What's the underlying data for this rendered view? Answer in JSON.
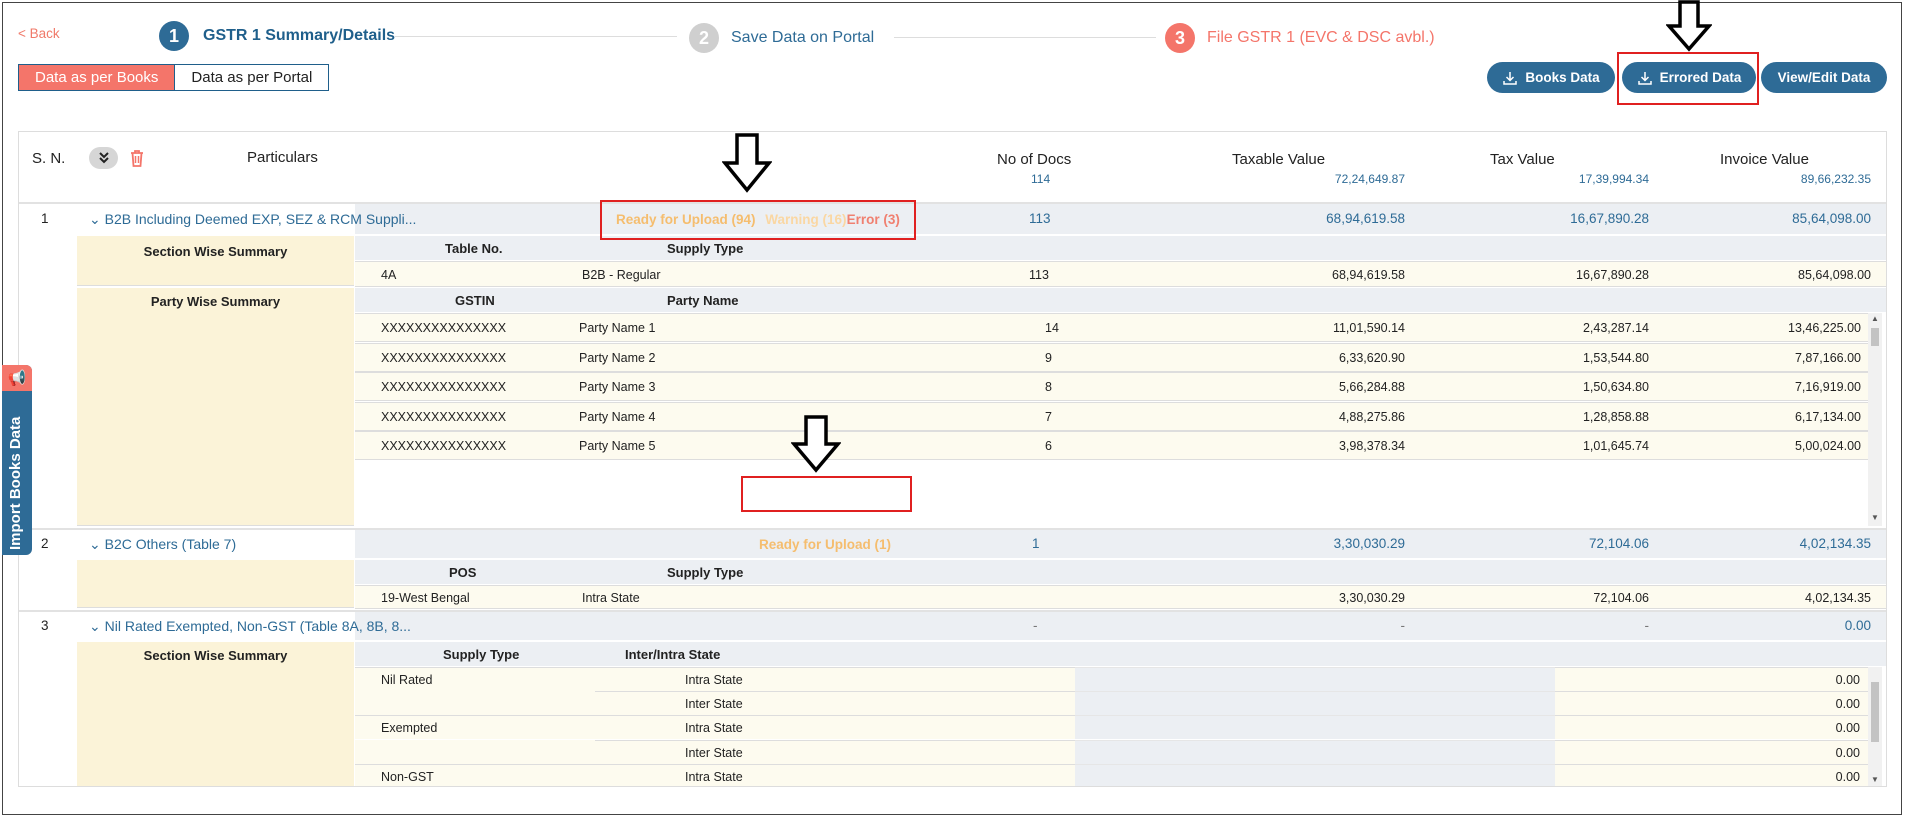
{
  "header": {
    "back": "< Back",
    "steps": [
      {
        "num": "1",
        "label": "GSTR 1 Summary/Details"
      },
      {
        "num": "2",
        "label": "Save Data on Portal"
      },
      {
        "num": "3",
        "label": "File GSTR 1 (EVC & DSC avbl.)"
      }
    ],
    "toggle": {
      "books": "Data as per Books",
      "portal": "Data as per Portal"
    },
    "buttons": {
      "books_data": "Books Data",
      "errored_data": "Errored Data",
      "view_edit": "View/Edit Data"
    }
  },
  "colors": {
    "brand": "#2e6b96",
    "accent": "#f4756a",
    "highlight": "#e02020"
  },
  "columns": {
    "sn": "S. N.",
    "particulars": "Particulars",
    "docs": "No of Docs",
    "taxable": "Taxable Value",
    "tax": "Tax Value",
    "invoice": "Invoice Value"
  },
  "totals": {
    "docs": "114",
    "taxable": "72,24,649.87",
    "tax": "17,39,994.34",
    "invoice": "89,66,232.35"
  },
  "sections": [
    {
      "sn": "1",
      "title": "B2B Including Deemed EXP, SEZ & RCM Suppli...",
      "status": {
        "ready": "Ready for Upload (94)",
        "warning": "Warning (16)",
        "error": "Error (3)"
      },
      "docs": "113",
      "taxable": "68,94,619.58",
      "tax": "16,67,890.28",
      "invoice": "85,64,098.00",
      "section_wise": {
        "label": "Section Wise Summary",
        "col1": "Table No.",
        "col2": "Supply Type",
        "row": {
          "c1": "4A",
          "c2": "B2B - Regular",
          "docs": "113",
          "taxable": "68,94,619.58",
          "tax": "16,67,890.28",
          "invoice": "85,64,098.00"
        }
      },
      "party_wise": {
        "label": "Party Wise Summary",
        "col1": "GSTIN",
        "col2": "Party Name",
        "rows": [
          {
            "gstin": "XXXXXXXXXXXXXXX",
            "party": "Party Name 1",
            "docs": "14",
            "taxable": "11,01,590.14",
            "tax": "2,43,287.14",
            "invoice": "13,46,225.00"
          },
          {
            "gstin": "XXXXXXXXXXXXXXX",
            "party": "Party Name 2",
            "docs": "9",
            "taxable": "6,33,620.90",
            "tax": "1,53,544.80",
            "invoice": "7,87,166.00"
          },
          {
            "gstin": "XXXXXXXXXXXXXXX",
            "party": "Party Name 3",
            "docs": "8",
            "taxable": "5,66,284.88",
            "tax": "1,50,634.80",
            "invoice": "7,16,919.00"
          },
          {
            "gstin": "XXXXXXXXXXXXXXX",
            "party": "Party Name 4",
            "docs": "7",
            "taxable": "4,88,275.86",
            "tax": "1,28,858.88",
            "invoice": "6,17,134.00"
          },
          {
            "gstin": "XXXXXXXXXXXXXXX",
            "party": "Party Name 5",
            "docs": "6",
            "taxable": "3,98,378.34",
            "tax": "1,01,645.74",
            "invoice": "5,00,024.00"
          }
        ]
      }
    },
    {
      "sn": "2",
      "title": "B2C Others (Table 7)",
      "status": {
        "ready": "Ready for Upload (1)"
      },
      "docs": "1",
      "taxable": "3,30,030.29",
      "tax": "72,104.06",
      "invoice": "4,02,134.35",
      "detail": {
        "col1": "POS",
        "col2": "Supply Type",
        "row": {
          "c1": "19-West Bengal",
          "c2": "Intra State",
          "taxable": "3,30,030.29",
          "tax": "72,104.06",
          "invoice": "4,02,134.35"
        }
      }
    },
    {
      "sn": "3",
      "title": "Nil Rated Exempted, Non-GST (Table 8A, 8B, 8...",
      "docs": "-",
      "taxable": "-",
      "tax": "-",
      "invoice": "0.00",
      "section_wise": {
        "label": "Section Wise Summary",
        "col1": "Supply Type",
        "col2": "Inter/Intra State",
        "rows": [
          {
            "type": "Nil Rated",
            "state": "Intra State",
            "value": "0.00"
          },
          {
            "type": "",
            "state": "Inter State",
            "value": "0.00"
          },
          {
            "type": "Exempted",
            "state": "Intra State",
            "value": "0.00"
          },
          {
            "type": "",
            "state": "Inter State",
            "value": "0.00"
          },
          {
            "type": "Non-GST",
            "state": "Intra State",
            "value": "0.00"
          }
        ]
      }
    }
  ],
  "side_tab": {
    "label": "Import Books Data"
  }
}
